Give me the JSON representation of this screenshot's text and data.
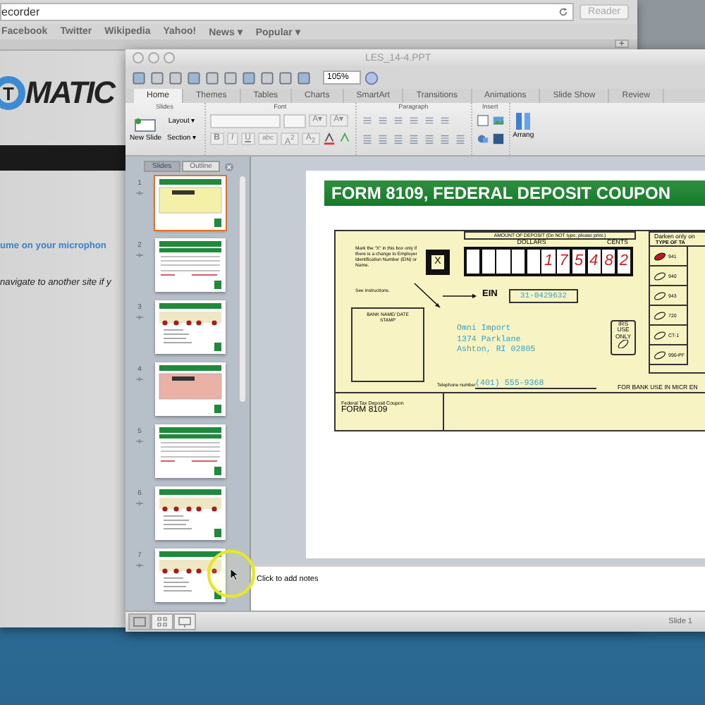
{
  "browser": {
    "address": "ecorder",
    "reader": "Reader",
    "new_tab": "+",
    "bookmarks": [
      "Facebook",
      "Twitter",
      "Wikipedia",
      "Yahoo!",
      "News ▾",
      "Popular ▾"
    ],
    "logo": {
      "letter": "T",
      "text": "MATIC"
    },
    "lines": [
      {
        "text": "ume on your microphon",
        "kind": "link"
      },
      {
        "text": "navigate to another site if y",
        "kind": "note"
      }
    ]
  },
  "ppt": {
    "title": "LES_14-4.PPT",
    "zoom": "105%",
    "tabs": [
      {
        "label": "Home",
        "selected": true
      },
      {
        "label": "Themes",
        "selected": false
      },
      {
        "label": "Tables",
        "selected": false
      },
      {
        "label": "Charts",
        "selected": false
      },
      {
        "label": "SmartArt",
        "selected": false
      },
      {
        "label": "Transitions",
        "selected": false
      },
      {
        "label": "Animations",
        "selected": false
      },
      {
        "label": "Slide Show",
        "selected": false
      },
      {
        "label": "Review",
        "selected": false
      }
    ],
    "groups": {
      "slides": "Slides",
      "font": "Font",
      "paragraph": "Paragraph",
      "insert": "Insert"
    },
    "new_slide": "New Slide",
    "layout": "Layout ▾",
    "section": "Section ▾",
    "arrange": "Arrang",
    "font_sizes": [
      "A▾",
      "A▾"
    ],
    "format_buttons": [
      "B",
      "I",
      "U",
      "abc",
      "A$^{2}$",
      "A$_{2}$"
    ],
    "pane_tabs": [
      {
        "label": "Slides",
        "selected": true
      },
      {
        "label": "Outline",
        "selected": false
      }
    ],
    "slides": [
      {
        "number": "1",
        "kind": "form-yellow",
        "selected": true
      },
      {
        "number": "2",
        "kind": "table",
        "selected": false
      },
      {
        "number": "3",
        "kind": "dots",
        "selected": false
      },
      {
        "number": "4",
        "kind": "form-pink",
        "selected": false
      },
      {
        "number": "5",
        "kind": "table",
        "selected": false
      },
      {
        "number": "6",
        "kind": "dots",
        "selected": false
      },
      {
        "number": "7",
        "kind": "dots",
        "selected": false
      }
    ],
    "notes_placeholder": "Click to add notes",
    "status": "Slide 1"
  },
  "slide": {
    "heading": "FORM 8109, FEDERAL DEPOSIT COUPON",
    "instructions": "Mark the \"X\" in this box only if there is a change to Employer Identification Number (EIN) or Name.",
    "see_instructions": "See instructions.",
    "x_mark": "X",
    "amount_label": "AMOUNT OF DEPOSIT (Do NOT type; please print.)",
    "dollars_label": "DOLLARS",
    "cents_label": "CENTS",
    "dollars": [
      "1",
      "7",
      "5",
      "4"
    ],
    "cents": [
      "8",
      "2"
    ],
    "ein_label": "EIN",
    "ein": "31-0429632",
    "bank_stamp": "BANK NAME/ DATE STAMP",
    "address": [
      "Omni Import",
      "1374 Parklane",
      "Ashton, RI 02805"
    ],
    "irs": "IRS USE ONLY",
    "phone_label": "Telephone number",
    "phone": "(401) 555-9368",
    "bank_use": "FOR BANK USE IN MICR EN",
    "darken": "Darken only on",
    "type_label": "TYPE OF TA",
    "types": [
      {
        "label": "941",
        "checked": true
      },
      {
        "label": "940",
        "checked": false
      },
      {
        "label": "943",
        "checked": false
      },
      {
        "label": "720",
        "checked": false
      },
      {
        "label": "CT-1",
        "checked": false
      },
      {
        "label": "990-PF",
        "checked": false
      }
    ],
    "footer_title": "Federal Tax Deposit Coupon",
    "footer_form": "FORM 8109"
  }
}
